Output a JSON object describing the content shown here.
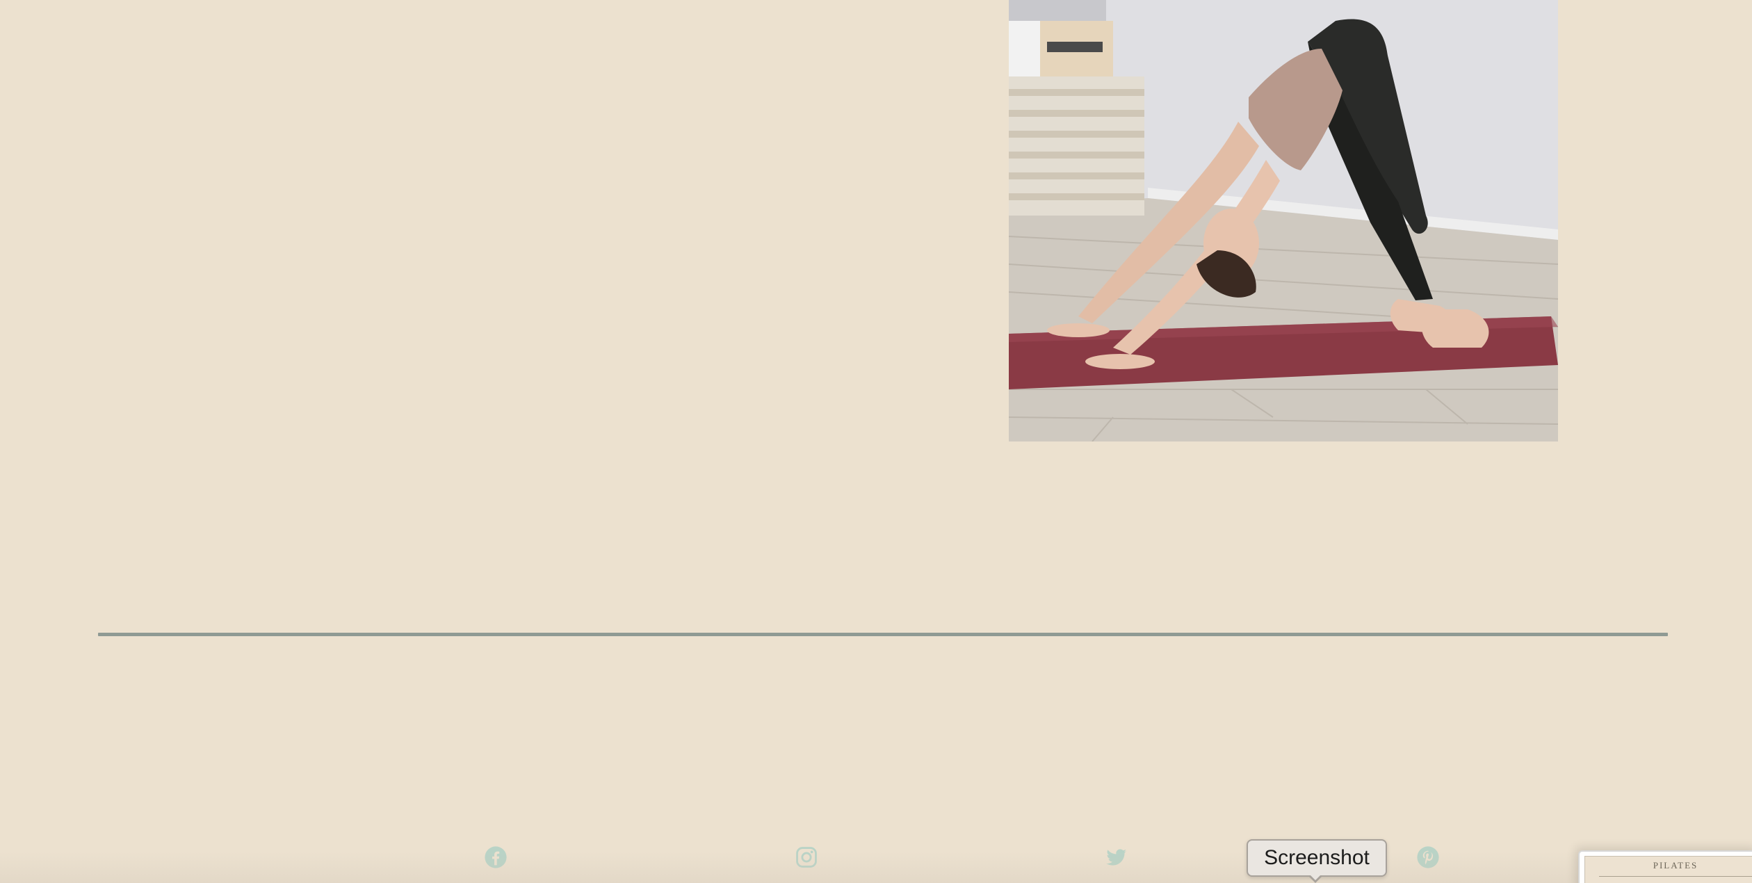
{
  "photo": {
    "alt": "Woman in downward dog pose on a red yoga mat",
    "colors": {
      "wall": "#dcdcdf",
      "floor": "#cfc8be",
      "mat": "#8a3a45",
      "leggings": "#2a2b29",
      "top": "#b8998c",
      "skin": "#e7c3ad"
    }
  },
  "divider": {
    "color": "#8f9a94"
  },
  "social": {
    "color": "#b9d3c6",
    "items": [
      {
        "name": "facebook",
        "icon": "facebook-icon"
      },
      {
        "name": "instagram",
        "icon": "instagram-icon"
      },
      {
        "name": "twitter",
        "icon": "twitter-icon"
      },
      {
        "name": "pinterest",
        "icon": "pinterest-icon"
      }
    ]
  },
  "tooltip": {
    "label": "Screenshot"
  },
  "thumbnail": {
    "title": "PILATES"
  }
}
